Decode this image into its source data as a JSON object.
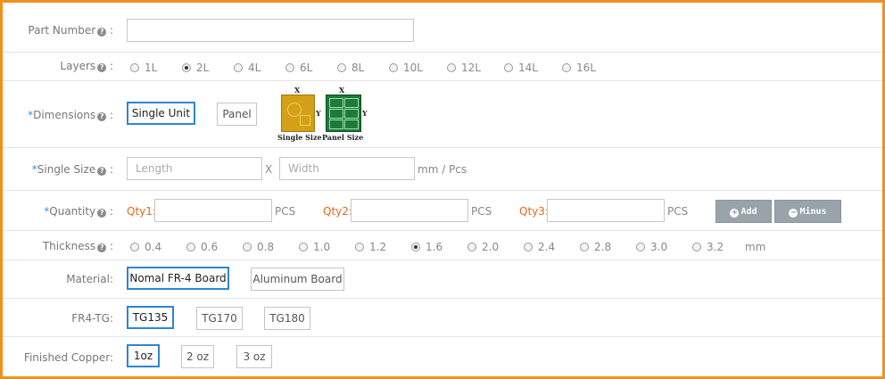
{
  "part_number": {
    "label": "Part Number",
    "value": ""
  },
  "layers": {
    "label": "Layers",
    "options": [
      "1L",
      "2L",
      "4L",
      "6L",
      "8L",
      "10L",
      "12L",
      "14L",
      "16L"
    ],
    "selected": "2L"
  },
  "dimensions": {
    "required": "*",
    "label": "Dimensions",
    "options": [
      "Single Unit",
      "Panel"
    ],
    "selected": "Single Unit",
    "images": {
      "single_caption": "Single Size",
      "panel_caption": "Panel Size",
      "x": "X",
      "y": "Y"
    }
  },
  "single_size": {
    "required": "*",
    "label": "Single Size",
    "length_placeholder": "Length",
    "width_placeholder": "Width",
    "separator": "X",
    "unit": "mm / Pcs"
  },
  "quantity": {
    "required": "*",
    "label": "Quantity",
    "qty1": "Qty1:",
    "qty2": "Qty2:",
    "qty3": "Qty3:",
    "unit": "PCS",
    "add_label": "Add",
    "minus_label": "Minus"
  },
  "thickness": {
    "label": "Thickness",
    "options": [
      "0.4",
      "0.6",
      "0.8",
      "1.0",
      "1.2",
      "1.6",
      "2.0",
      "2.4",
      "2.8",
      "3.0",
      "3.2"
    ],
    "selected": "1.6",
    "unit": "mm"
  },
  "material": {
    "label": "Material:",
    "options": [
      "Nomal FR-4 Board",
      "Aluminum Board"
    ],
    "selected": "Nomal FR-4 Board"
  },
  "fr4_tg": {
    "label": "FR4-TG:",
    "options": [
      "TG135",
      "TG170",
      "TG180"
    ],
    "selected": "TG135"
  },
  "finished_copper": {
    "label": "Finished Copper:",
    "options": [
      "1oz",
      "2 oz",
      "3 oz"
    ],
    "selected": "1oz"
  },
  "colors": {
    "border": "#f0901f",
    "selected": "#2e86d4",
    "qty": "#e36b1e",
    "required": "#3a8ee6"
  }
}
